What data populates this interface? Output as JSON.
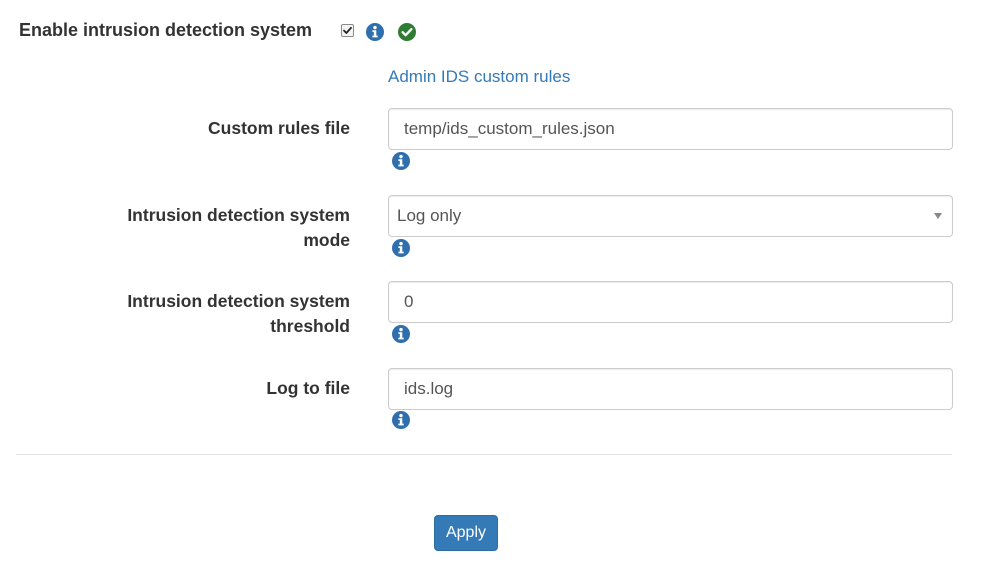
{
  "enable_ids": {
    "label": "Enable intrusion detection system",
    "checked": true
  },
  "admin_link": {
    "text": "Admin IDS custom rules"
  },
  "fields": {
    "custom_rules_file": {
      "label": "Custom rules file",
      "value": "temp/ids_custom_rules.json"
    },
    "ids_mode": {
      "label_line1": "Intrusion detection system",
      "label_line2": "mode",
      "value": "Log only"
    },
    "ids_threshold": {
      "label_line1": "Intrusion detection system",
      "label_line2": "threshold",
      "value": "0"
    },
    "log_to_file": {
      "label": "Log to file",
      "value": "ids.log"
    }
  },
  "apply_button": {
    "label": "Apply"
  },
  "colors": {
    "link": "#337ab7",
    "info_icon": "#2f6fad",
    "ok_icon": "#2e7d32",
    "button": "#337ab7"
  },
  "icons": {
    "info": "info-icon",
    "ok": "check-circle-icon",
    "dropdown": "caret-down-icon"
  }
}
